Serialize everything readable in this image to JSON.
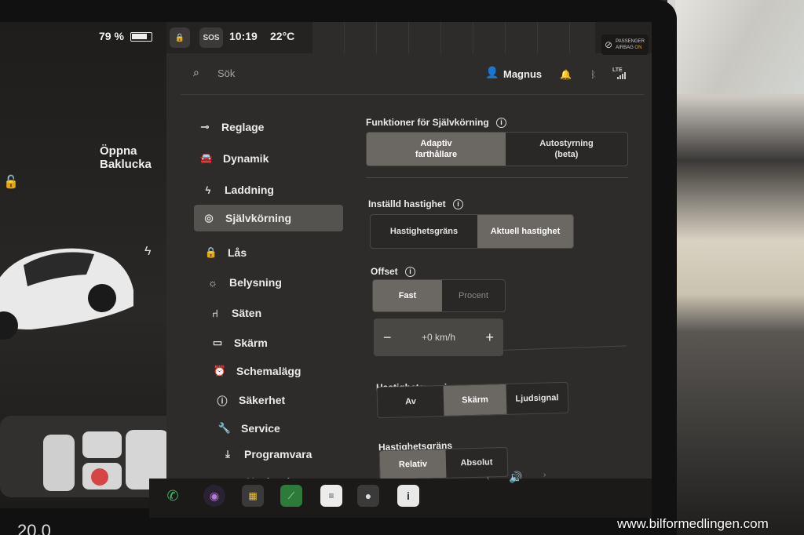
{
  "status": {
    "battery_percent": "79 %",
    "sos": "SOS",
    "time": "10:19",
    "temperature": "22°C",
    "airbag_line1": "PASSENGER",
    "airbag_line2": "AIRBAG",
    "airbag_state": "ON"
  },
  "car": {
    "trunk_line1": "Öppna",
    "trunk_line2": "Baklucka",
    "cabin_temp": "20.0"
  },
  "header": {
    "search_placeholder": "Sök",
    "user_name": "Magnus",
    "network": "LTE"
  },
  "sidebar": {
    "items": [
      {
        "label": "Reglage",
        "icon": "toggle-icon"
      },
      {
        "label": "Dynamik",
        "icon": "car-icon"
      },
      {
        "label": "Laddning",
        "icon": "bolt-icon"
      },
      {
        "label": "Självkörning",
        "icon": "steering-wheel-icon",
        "active": true
      },
      {
        "label": "Lås",
        "icon": "lock-icon"
      },
      {
        "label": "Belysning",
        "icon": "sun-icon"
      },
      {
        "label": "Säten",
        "icon": "seat-icon"
      },
      {
        "label": "Skärm",
        "icon": "display-icon"
      },
      {
        "label": "Schemalägg",
        "icon": "alarm-clock-icon"
      },
      {
        "label": "Säkerhet",
        "icon": "info-circle-icon"
      },
      {
        "label": "Service",
        "icon": "wrench-icon"
      },
      {
        "label": "Programvara",
        "icon": "download-icon"
      },
      {
        "label": "Navigering",
        "icon": "navigation-arrow-icon"
      }
    ]
  },
  "autopilot": {
    "features_title": "Funktioner för Självkörning",
    "features_options": [
      {
        "line1": "Adaptiv",
        "line2": "farthållare",
        "selected": true
      },
      {
        "line1": "Autostyrning",
        "line2": "(beta)",
        "selected": false
      }
    ],
    "speed_title": "Inställd hastighet",
    "speed_options": [
      {
        "label": "Hastighetsgräns",
        "selected": false
      },
      {
        "label": "Aktuell hastighet",
        "selected": true
      }
    ],
    "offset_title": "Offset",
    "offset_options": [
      {
        "label": "Fast",
        "selected": true
      },
      {
        "label": "Procent",
        "selected": false
      }
    ],
    "offset_value": "+0 km/h",
    "offset_minus": "−",
    "offset_plus": "+",
    "warning_title": "Hastighetsvarning",
    "warning_options": [
      {
        "label": "Av",
        "selected": false
      },
      {
        "label": "Skärm",
        "selected": true
      },
      {
        "label": "Ljudsignal",
        "selected": false
      }
    ],
    "limit_title": "Hastighetsgräns",
    "limit_options": [
      {
        "label": "Relativ",
        "selected": true
      },
      {
        "label": "Absolut",
        "selected": false
      }
    ]
  },
  "dock": {
    "icons": [
      "phone-icon",
      "camera-lens-icon",
      "apps-icon",
      "energy-graph-icon",
      "notes-icon",
      "dashcam-icon",
      "info-icon"
    ]
  },
  "watermark": "www.bilformedlingen.com",
  "colors": {
    "selected_segment": "#6b6864",
    "panel_bg": "#2e2c2a",
    "airbag_on": "#e8a23a",
    "phone_green": "#3fbf5a"
  }
}
